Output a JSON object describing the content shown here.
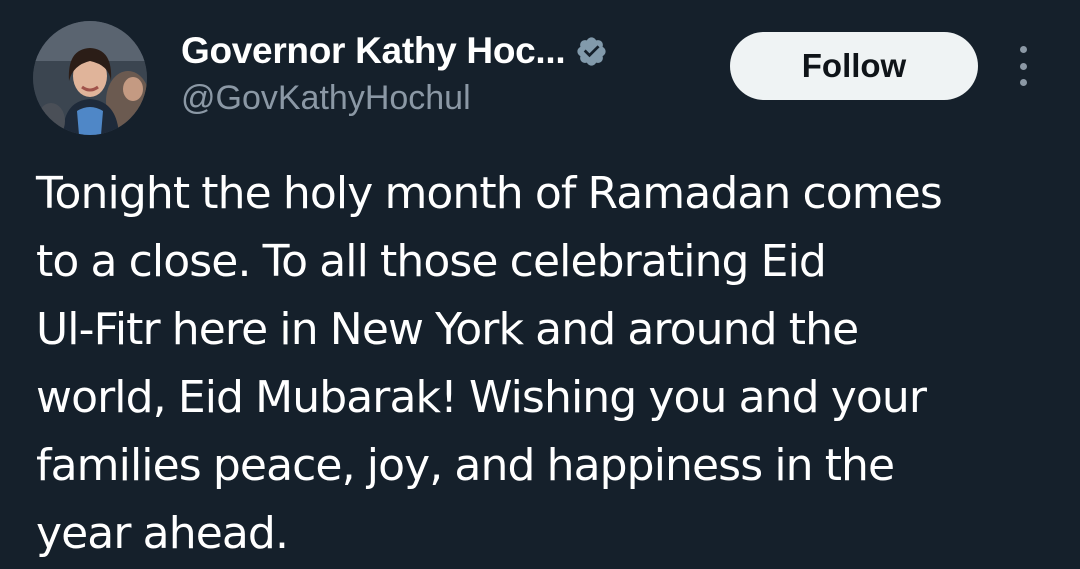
{
  "author": {
    "display_name": "Governor Kathy Hoc...",
    "handle": "@GovKathyHochul",
    "verified_icon": "verified-badge-icon",
    "avatar": "profile-photo"
  },
  "actions": {
    "follow_label": "Follow",
    "more_icon": "more-vertical-icon"
  },
  "tweet": {
    "lines": [
      "Tonight the holy month of Ramadan comes",
      "to a close. To all those celebrating Eid",
      "Ul-Fitr here in New York and around the",
      "world, Eid Mubarak! Wishing you and your",
      "families peace, joy, and happiness in the",
      "year ahead."
    ]
  },
  "colors": {
    "background": "#15202b",
    "text_primary": "#ffffff",
    "text_secondary": "#8b98a5",
    "verified_badge": "#829aab",
    "follow_bg": "#eff3f4"
  }
}
